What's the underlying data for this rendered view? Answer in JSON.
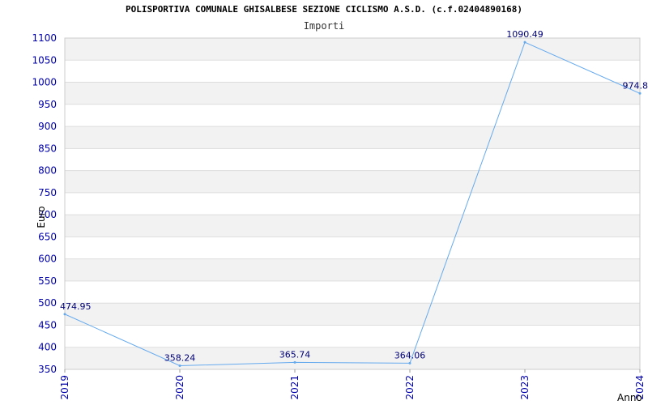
{
  "chart_data": {
    "type": "line",
    "title": "POLISPORTIVA COMUNALE GHISALBESE SEZIONE CICLISMO A.S.D. (c.f.02404890168)",
    "subtitle": "Importi",
    "xlabel": "Anno",
    "ylabel": "Euro",
    "categories": [
      "2019",
      "2020",
      "2021",
      "2022",
      "2023",
      "2024"
    ],
    "values": [
      474.95,
      358.24,
      365.74,
      364.06,
      1090.49,
      974.8
    ],
    "data_labels": [
      "474.95",
      "358.24",
      "365.74",
      "364.06",
      "1090.49",
      "974.8"
    ],
    "ylim": [
      350,
      1100
    ],
    "yticks": [
      350,
      400,
      450,
      500,
      550,
      600,
      650,
      700,
      750,
      800,
      850,
      900,
      950,
      1000,
      1050,
      1100
    ],
    "grid": true,
    "band_colors": [
      "#ffffff",
      "#f2f2f2"
    ],
    "line_color": "#66aaee",
    "tick_color": "#0000aa"
  }
}
